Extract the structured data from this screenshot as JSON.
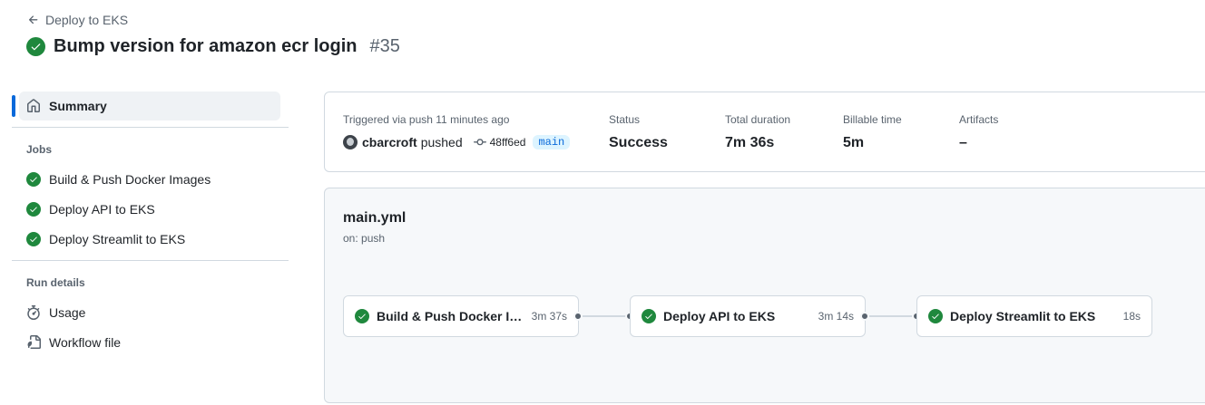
{
  "header": {
    "back_label": "Deploy to EKS",
    "run_title": "Bump version for amazon ecr login",
    "run_number": "#35",
    "status_color": "#1f883d"
  },
  "sidebar": {
    "summary_label": "Summary",
    "jobs_title": "Jobs",
    "jobs": [
      {
        "label": "Build & Push Docker Images",
        "icon": "check-circle-icon"
      },
      {
        "label": "Deploy API to EKS",
        "icon": "check-circle-icon"
      },
      {
        "label": "Deploy Streamlit to EKS",
        "icon": "check-circle-icon"
      }
    ],
    "run_details_title": "Run details",
    "run_details": [
      {
        "label": "Usage",
        "icon": "stopwatch-icon"
      },
      {
        "label": "Workflow file",
        "icon": "file-code-icon"
      }
    ]
  },
  "summary": {
    "triggered_label": "Triggered via push 11 minutes ago",
    "actor": "cbarcroft",
    "action": "pushed",
    "commit": "48ff6ed",
    "branch": "main",
    "status_label": "Status",
    "status_value": "Success",
    "duration_label": "Total duration",
    "duration_value": "7m 36s",
    "billable_label": "Billable time",
    "billable_value": "5m",
    "artifacts_label": "Artifacts",
    "artifacts_value": "–"
  },
  "workflow": {
    "file_name": "main.yml",
    "trigger": "on: push",
    "jobs": [
      {
        "name": "Build & Push Docker Im...",
        "duration": "3m 37s"
      },
      {
        "name": "Deploy API to EKS",
        "duration": "3m 14s"
      },
      {
        "name": "Deploy Streamlit to EKS",
        "duration": "18s"
      }
    ]
  },
  "colors": {
    "success": "#1f883d",
    "accent": "#0969da",
    "border": "#d1d9e0",
    "muted": "#59636e"
  }
}
